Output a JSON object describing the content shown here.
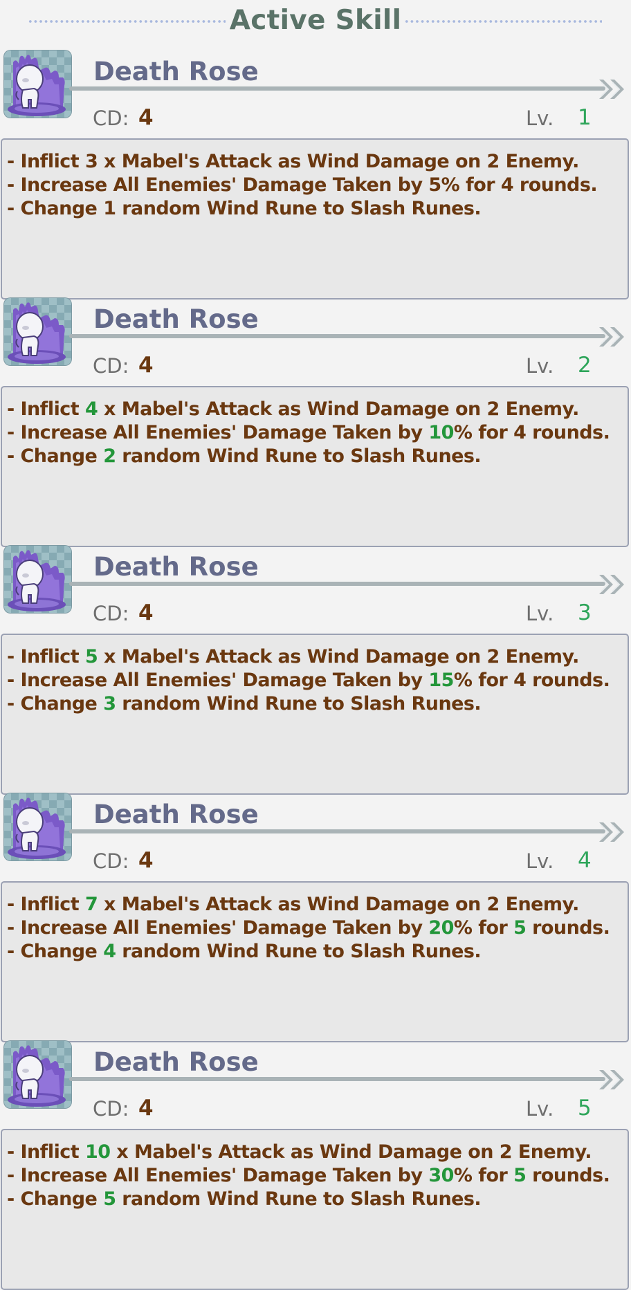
{
  "header": {
    "title": "Active Skill"
  },
  "colors": {
    "highlight": "#23963a",
    "text": "#6a3810",
    "name": "#646a8a"
  },
  "skills": [
    {
      "name": "Death Rose",
      "cd_label": "CD:",
      "cd": "4",
      "lv_label": "Lv.",
      "lv": "1",
      "lines": [
        [
          "- Inflict ",
          "3",
          " x Mabel's Attack as Wind Damage on 2 Enemy.",
          "",
          ""
        ],
        [
          "- Increase All Enemies' Damage Taken by ",
          "5",
          "% for ",
          "4",
          " rounds."
        ],
        [
          "- Change ",
          "1",
          " random Wind Rune to Slash Runes.",
          "",
          ""
        ]
      ],
      "highlighted": false
    },
    {
      "name": "Death Rose",
      "cd_label": "CD:",
      "cd": "4",
      "lv_label": "Lv.",
      "lv": "2",
      "lines": [
        [
          "- Inflict ",
          "4",
          " x Mabel's Attack as Wind Damage on 2 Enemy.",
          "",
          ""
        ],
        [
          "- Increase All Enemies' Damage Taken by ",
          "10",
          "% for ",
          "4",
          " rounds."
        ],
        [
          "- Change ",
          "2",
          " random Wind Rune to Slash Runes.",
          "",
          ""
        ]
      ],
      "highlighted": true,
      "highlight_rounds": false
    },
    {
      "name": "Death Rose",
      "cd_label": "CD:",
      "cd": "4",
      "lv_label": "Lv.",
      "lv": "3",
      "lines": [
        [
          "- Inflict ",
          "5",
          " x Mabel's Attack as Wind Damage on 2 Enemy.",
          "",
          ""
        ],
        [
          "- Increase All Enemies' Damage Taken by ",
          "15",
          "% for ",
          "4",
          " rounds."
        ],
        [
          "- Change ",
          "3",
          " random Wind Rune to Slash Runes.",
          "",
          ""
        ]
      ],
      "highlighted": true,
      "highlight_rounds": false
    },
    {
      "name": "Death Rose",
      "cd_label": "CD:",
      "cd": "4",
      "lv_label": "Lv.",
      "lv": "4",
      "lines": [
        [
          "- Inflict ",
          "7",
          " x Mabel's Attack as Wind Damage on 2 Enemy.",
          "",
          ""
        ],
        [
          "- Increase All Enemies' Damage Taken by ",
          "20",
          "% for ",
          "5",
          " rounds."
        ],
        [
          "- Change ",
          "4",
          " random Wind Rune to Slash Runes.",
          "",
          ""
        ]
      ],
      "highlighted": true,
      "highlight_rounds": true
    },
    {
      "name": "Death Rose",
      "cd_label": "CD:",
      "cd": "4",
      "lv_label": "Lv.",
      "lv": "5",
      "lines": [
        [
          "- Inflict ",
          "10",
          " x Mabel's Attack as Wind Damage on 2 Enemy.",
          "",
          ""
        ],
        [
          "- Increase All Enemies' Damage Taken by ",
          "30",
          "% for ",
          "5",
          " rounds."
        ],
        [
          "- Change ",
          "5",
          " random Wind Rune to Slash Runes.",
          "",
          ""
        ]
      ],
      "highlighted": true,
      "highlight_rounds": true
    }
  ]
}
